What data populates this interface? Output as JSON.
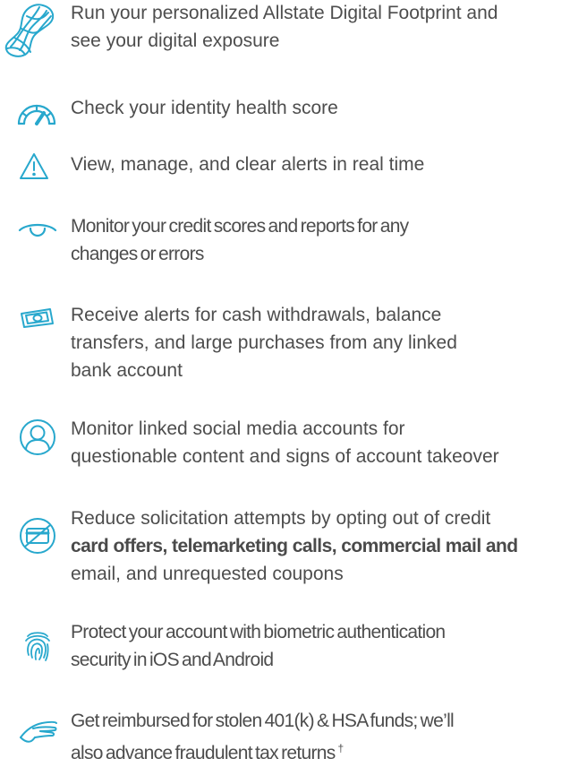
{
  "accent_color": "#28a8cd",
  "features": [
    {
      "icon": "fingerprint-globe-icon",
      "lines": [
        "Run your personalized Allstate Digital Footprint and",
        "see your digital exposure"
      ]
    },
    {
      "icon": "gauge-icon",
      "lines": [
        "Check your identity health score"
      ]
    },
    {
      "icon": "warning-triangle-icon",
      "lines": [
        "View, manage, and clear alerts in real time"
      ]
    },
    {
      "icon": "eye-icon",
      "lines": [
        "Monitor your credit scores and reports for any",
        "changes or errors"
      ]
    },
    {
      "icon": "money-bill-icon",
      "lines": [
        "Receive alerts for cash withdrawals, balance",
        "transfers, and large purchases from any linked",
        "bank account"
      ]
    },
    {
      "icon": "user-profile-icon",
      "lines": [
        "Monitor linked social media accounts for",
        "questionable content and signs of account takeover"
      ]
    },
    {
      "icon": "blocked-card-icon",
      "lines": [
        "Reduce solicitation attempts by opting out of credit",
        "card offers, telemarketing calls, commercial mail and",
        "email, and unrequested coupons"
      ]
    },
    {
      "icon": "fingerprint-icon",
      "lines": [
        "Protect your account with biometric authentication",
        "security in iOS and Android"
      ]
    },
    {
      "icon": "hand-icon",
      "lines": [
        "Get reimbursed for stolen 401(k) & HSA funds; we’ll",
        "also advance fraudulent tax returns"
      ],
      "footnote_mark": "†"
    }
  ]
}
